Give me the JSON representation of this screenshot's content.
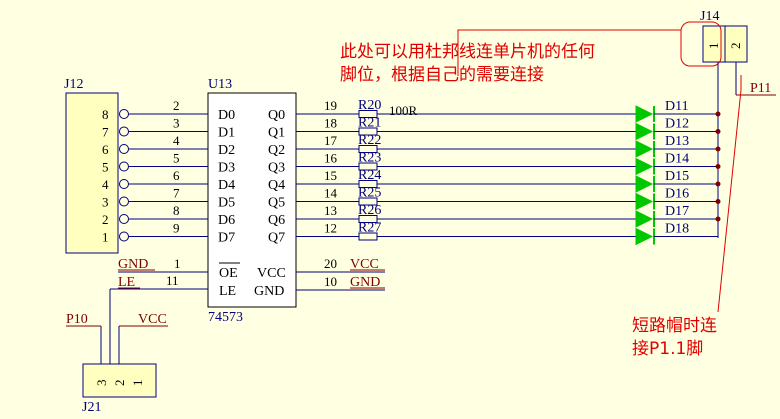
{
  "colors": {
    "background": "#FFFFE1",
    "component_fill": "#FFFFC0",
    "wire": "#000080",
    "net_label": "#800000",
    "led": "#00C800",
    "annotation": "#E00000",
    "junction": "#800000"
  },
  "annotations": {
    "top_line1": "此处可以用杜邦线连单片机的任何",
    "top_line2": "脚位，根据自己的需要连接",
    "bottom_line1": "短路帽时连",
    "bottom_line2": "接P1.1脚"
  },
  "j12": {
    "designator": "J12",
    "pins": [
      "8",
      "7",
      "6",
      "5",
      "4",
      "3",
      "2",
      "1"
    ]
  },
  "u13": {
    "designator": "U13",
    "part": "74573",
    "left_pin_numbers": [
      "2",
      "3",
      "4",
      "5",
      "6",
      "7",
      "8",
      "9"
    ],
    "left_pin_names": [
      "D0",
      "D1",
      "D2",
      "D3",
      "D4",
      "D5",
      "D6",
      "D7"
    ],
    "right_pin_numbers": [
      "19",
      "18",
      "17",
      "16",
      "15",
      "14",
      "13",
      "12"
    ],
    "right_pin_names": [
      "Q0",
      "Q1",
      "Q2",
      "Q3",
      "Q4",
      "Q5",
      "Q6",
      "Q7"
    ],
    "oe_pin": "1",
    "oe_name": "OE",
    "le_pin": "11",
    "le_name": "LE",
    "vcc_pin": "20",
    "vcc_name": "VCC",
    "gnd_pin": "10",
    "gnd_name": "GND"
  },
  "nets": {
    "gnd_left": "GND",
    "le_net": "LE",
    "vcc_right": "VCC",
    "gnd_right": "GND"
  },
  "resistors": {
    "names": [
      "R20",
      "R21",
      "R22",
      "R23",
      "R24",
      "R25",
      "R26",
      "R27"
    ],
    "value": "100R"
  },
  "leds": {
    "names": [
      "D11",
      "D12",
      "D13",
      "D14",
      "D15",
      "D16",
      "D17",
      "D18"
    ]
  },
  "j14": {
    "designator": "J14",
    "pins": [
      "1",
      "2"
    ],
    "net": "P11"
  },
  "j21": {
    "designator": "J21",
    "pins": [
      "3",
      "2",
      "1"
    ],
    "net_p10": "P10",
    "net_vcc": "VCC"
  }
}
